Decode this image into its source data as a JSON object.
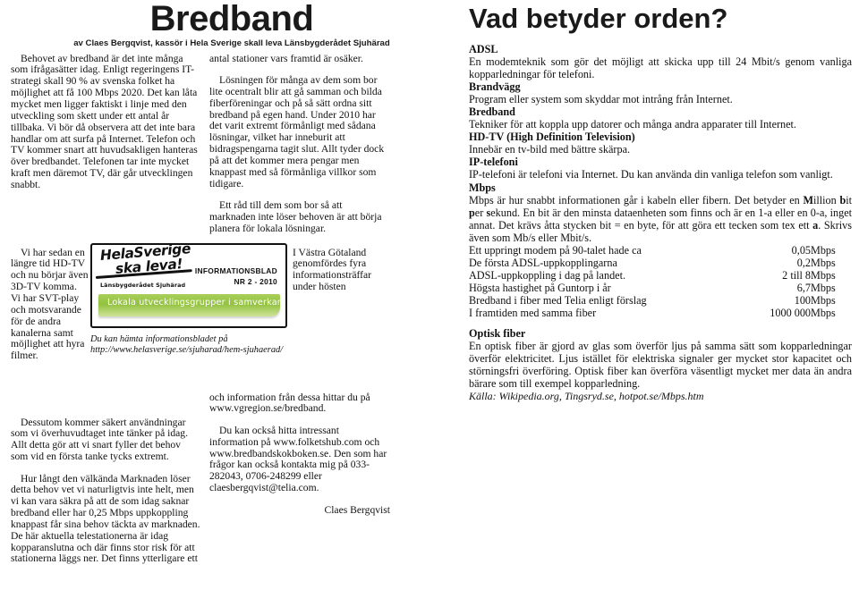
{
  "header": {
    "left_title": "Bredband",
    "byline": "av Claes Bergqvist, kassör i Hela Sverige skall leva Länsbygderådet Sjuhärad",
    "right_title": "Vad betyder orden?"
  },
  "article": {
    "col1_part1": "Behovet av bredband är det inte många som ifrågasätter idag. Enligt regeringens IT-strategi skall 90 % av svenska folket ha möjlighet att få 100 Mbps 2020. Det kan låta mycket men ligger faktiskt i linje med den utveckling som skett under ett antal år tillbaka. Vi bör då observera att det inte bara handlar om att surfa på Internet. Telefon och TV kommer snart att huvudsakligen hanteras över bredbandet. Telefonen tar inte mycket kraft men däremot TV, där går utvecklingen snabbt.",
    "col1_part2": "Vi har sedan en längre tid HD-TV och nu börjar även 3D-TV komma. Vi har SVT-play och motsvarande för de andra kanalerna samt möjlighet att hyra filmer.",
    "col1_part3": "Dessutom kommer säkert användningar som vi överhuvudtaget inte tänker på idag. Allt detta gör att vi snart fyller det behov som vid en första tanke tycks extremt.",
    "col1_part4": "Hur långt  den välkända Marknaden löser detta behov vet vi naturligtvis inte helt, men vi kan vara säkra på att de som idag saknar bredband eller har 0,25 Mbps uppkoppling knappast får sina behov täckta av marknaden. De här aktuella telestationerna är idag kopparanslutna och där finns stor risk för att stationerna läggs ner. Det finns ytterligare ett",
    "col2_part1": "antal stationer vars framtid är osäker.",
    "col2_part2": "Lösningen för många av dem som bor lite ocentralt blir att gå samman och bilda fiberföreningar och på så sätt ordna sitt bredband på egen hand. Under 2010 har det varit extremt förmånligt med sådana lösningar, vilket har inneburit att bidragspengarna tagit slut. Allt tyder dock på att det kommer mera pengar men knappast med så förmånliga villkor som tidigare.",
    "col2_part3": "Ett råd till dem som bor så att marknaden inte löser behoven är att börja planera för lokala lösningar.",
    "col2_part4": "I Västra Götaland genomfördes fyra informationsträffar under hösten",
    "col2_part5": "och information från dessa hittar du på www.vgregion.se/bredband.",
    "col2_part6": "Du kan också hitta intressant information på www.folketshub.com och www.bredbandskokboken.se.      Den som har frågor kan också kontakta mig på 033-282043, 0706-248299 eller claesbergqvist@telia.com.",
    "signature": "Claes Bergqvist"
  },
  "logo_box": {
    "brand_line1": "HelaSverige",
    "brand_line2": "ska leva!",
    "subtitle": "Länsbygderådet Sjuhärad",
    "info_line1": "INFORMATIONSBLAD",
    "info_line2": "NR 2 - 2010",
    "banner_text": "Lokala utvecklingsgrupper i samverkan i Sjuhärad",
    "banner_color": "#93c23f",
    "caption_line1": "Du kan hämta informationsbladet på",
    "caption_line2": "http://www.helasverige.se/sjuharad/hem-sjuhaerad/"
  },
  "glossary": {
    "entries": [
      {
        "term": "ADSL",
        "definition": "En modemteknik som gör det möjligt att skicka upp till 24 Mbit/s genom vanliga kopparledningar för telefoni."
      },
      {
        "term": "Brandvägg",
        "definition": "Program eller system som skyddar mot intrång från Internet."
      },
      {
        "term": "Bredband",
        "definition": "Tekniker för att koppla upp datorer och många andra apparater till Internet."
      },
      {
        "term": "HD-TV (High Definition Television)",
        "definition": "Innebär en tv-bild med bättre skärpa."
      },
      {
        "term": "IP-telefoni",
        "definition": "IP-telefoni är telefoni via Internet. Du kan använda din vanliga telefon som vanligt."
      }
    ],
    "mbps": {
      "term": "Mbps",
      "def_line1": "Mbps är hur snabbt informationen går i kabeln eller fibern. Det betyder en",
      "def_line2_pre": "",
      "def_bold_1": "M",
      "def_bold_1_rest": "illion ",
      "def_bold_2": "b",
      "def_bold_2_rest": "it ",
      "def_bold_3": "p",
      "def_bold_3_rest": "er ",
      "def_bold_4": "s",
      "def_bold_4_rest": "ekund.",
      "def_line2_post": " En bit  är den minsta dataenheten som finns och är en 1-a eller en 0-a, inget annat. Det krävs åtta stycken bit = en byte, för att göra ett tecken som tex ett ",
      "def_bold_5": "a",
      "def_line3_post": ". Skrivs även som Mb/s eller Mbit/s."
    },
    "speed_table": {
      "rows": [
        {
          "label": "Ett uppringt modem på 90-talet hade ca",
          "value": "0,05",
          "unit": "Mbps"
        },
        {
          "label": "De första ADSL-uppkopplingarna",
          "value": "0,2",
          "unit": "Mbps"
        },
        {
          "label": "ADSL-uppkoppling i dag på landet.",
          "value": "2 till 8",
          "unit": "Mbps"
        },
        {
          "label": "Högsta hastighet på Guntorp i år",
          "value": "6,7",
          "unit": "Mbps"
        },
        {
          "label": "Bredband i fiber med Telia enligt förslag",
          "value": "100",
          "unit": "Mbps"
        },
        {
          "label": "I framtiden med samma fiber",
          "value": "1000 000",
          "unit": "Mbps"
        }
      ]
    },
    "optisk_fiber": {
      "term": "Optisk fiber",
      "definition": "En optisk fiber är gjord av glas som överför ljus på samma sätt som kopparledningar överför elektricitet. Ljus istället för elektriska signaler ger mycket stor kapacitet och störningsfri överföring. Optisk fiber kan överföra väsentligt mycket mer data än andra bärare som till exempel kopparledning."
    },
    "source": "Källa: Wikipedia.org, Tingsryd.se, hotpot.se/Mbps.htm"
  }
}
